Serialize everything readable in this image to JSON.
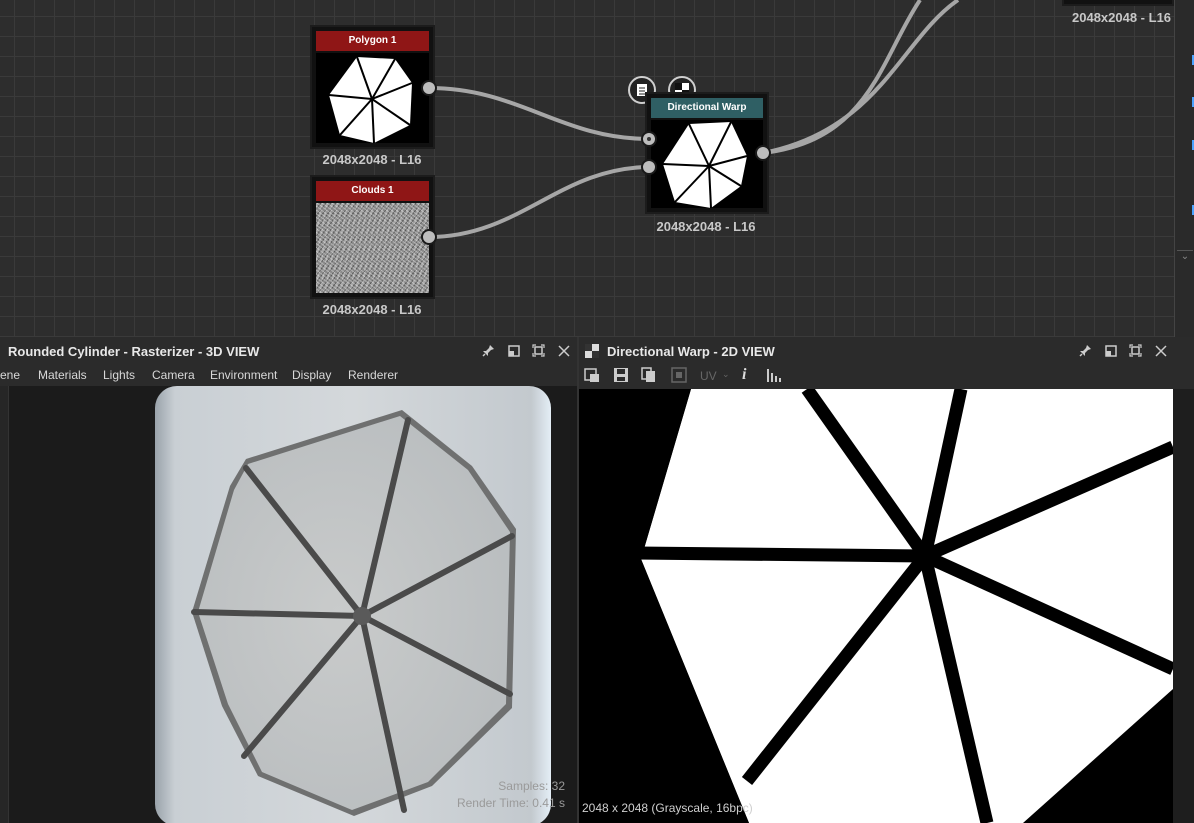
{
  "graph": {
    "nodes": {
      "polygon": {
        "title": "Polygon 1",
        "label": "2048x2048 - L16",
        "title_color": "#8f1616"
      },
      "clouds": {
        "title": "Clouds 1",
        "label": "2048x2048 - L16",
        "title_color": "#8f1616"
      },
      "warp": {
        "title": "Directional Warp",
        "label": "2048x2048 - L16",
        "title_color": "#2f5f64"
      },
      "offscreen": {
        "label": "2048x2048 - L16"
      }
    },
    "badges": [
      "document-icon",
      "checker-icon"
    ]
  },
  "panel3d": {
    "title": "Rounded Cylinder - Rasterizer - 3D VIEW",
    "menu": [
      "ene",
      "Materials",
      "Lights",
      "Camera",
      "Environment",
      "Display",
      "Renderer"
    ],
    "samples": "Samples: 32",
    "render_time": "Render Time: 0.41 s"
  },
  "panel2d": {
    "title": "Directional Warp - 2D VIEW",
    "toolbar": {
      "uv": "UV",
      "info": "i",
      "icons": [
        "view-mode-icon",
        "save-icon",
        "copy-icon",
        "tile-icon",
        "info-icon",
        "histogram-icon"
      ]
    },
    "status": "2048 x 2048 (Grayscale, 16bpc)"
  },
  "colors": {
    "wire": "#a6a6a6",
    "node_red": "#8f1616",
    "node_teal": "#2f5f64"
  }
}
